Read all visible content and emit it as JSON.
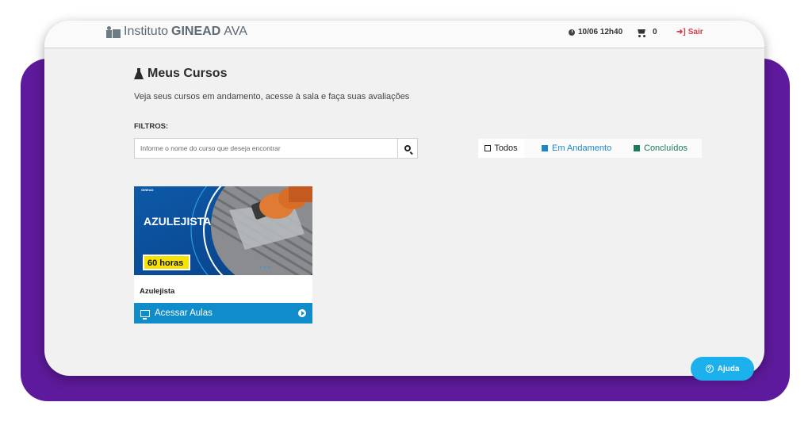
{
  "header": {
    "brand_prefix": "Instituto",
    "brand_bold": "GINEAD",
    "brand_suffix": "AVA",
    "datetime": "10/06 12h40",
    "cart_count": "0",
    "logout_label": "Sair",
    "icons": [
      "brand-icon",
      "clock-icon",
      "cart-icon",
      "sign-out-icon"
    ]
  },
  "page": {
    "title": "Meus Cursos",
    "subtitle": "Veja seus cursos em andamento, acesse à sala e faça suas avaliações",
    "filters_label": "FILTROS:"
  },
  "search": {
    "placeholder": "Informe o nome do curso que deseja encontrar",
    "value": ""
  },
  "filter_tabs": [
    {
      "label": "Todos",
      "color": "#222222"
    },
    {
      "label": "Em Andamento",
      "color": "#1f86c6"
    },
    {
      "label": "Concluídos",
      "color": "#1b7a5a"
    }
  ],
  "courses": [
    {
      "name": "Azulejista",
      "thumb_logo": "GINEAD",
      "thumb_title": "AZULEJISTA",
      "thumb_hours": "60 horas",
      "button_label": "Acessar Aulas"
    }
  ],
  "help": {
    "label": "Ajuda"
  },
  "colors": {
    "accent_blue": "#0f8cc9",
    "purple_bg": "#5e1a9c",
    "help_blue": "#1cb0ec",
    "logout_red": "#d43a4a",
    "hours_badge": "#f5e400"
  }
}
